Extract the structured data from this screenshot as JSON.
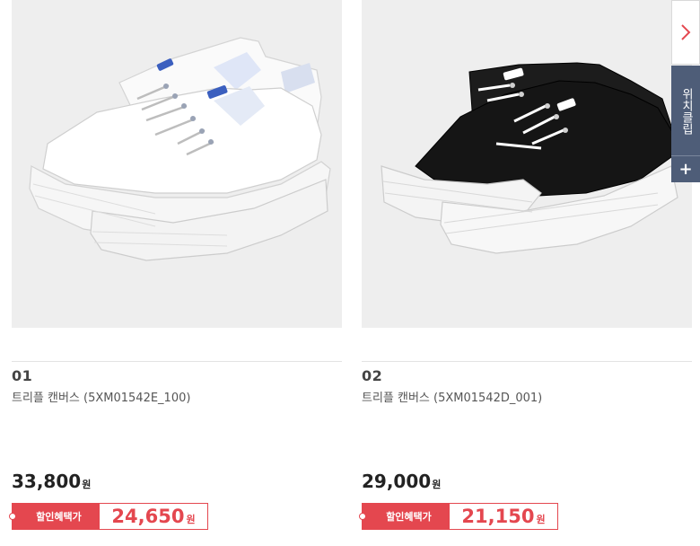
{
  "products": [
    {
      "number": "01",
      "name": "트리플 캔버스 (5XM01542E_100)",
      "price": "33,800",
      "price_unit": "원",
      "sale_label": "할인혜택가",
      "sale_price": "24,650",
      "sale_unit": "원",
      "image": "white-platform-sneakers"
    },
    {
      "number": "02",
      "name": "트리플 캔버스 (5XM01542D_001)",
      "price": "29,000",
      "price_unit": "원",
      "sale_label": "할인혜택가",
      "sale_price": "21,150",
      "sale_unit": "원",
      "image": "black-platform-sneakers"
    }
  ],
  "side_widget": {
    "arrow_icon": "chevron-right-icon",
    "label": "위치클립",
    "plus_icon": "plus-icon",
    "plus_glyph": "+"
  },
  "colors": {
    "accent": "#e4474f",
    "widget": "#4e5d78",
    "photo_bg": "#eeeeee"
  }
}
